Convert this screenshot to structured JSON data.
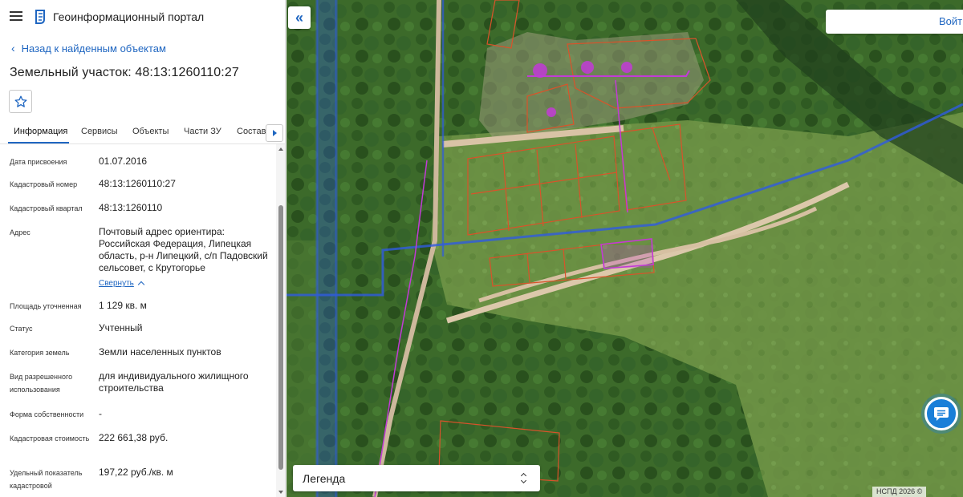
{
  "header": {
    "app_title": "Геоинформационный портал"
  },
  "nav": {
    "back_label": "Назад к найденным объектам"
  },
  "object": {
    "title": "Земельный участок: 48:13:1260110:27"
  },
  "tabs": [
    {
      "label": "Информация",
      "active": true
    },
    {
      "label": "Сервисы"
    },
    {
      "label": "Объекты"
    },
    {
      "label": "Части ЗУ"
    },
    {
      "label": "Состав"
    }
  ],
  "info": {
    "date_label": "Дата присвоения",
    "date_value": "01.07.2016",
    "cad_num_label": "Кадастровый номер",
    "cad_num_value": "48:13:1260110:27",
    "quarter_label": "Кадастровый квартал",
    "quarter_value": "48:13:1260110",
    "address_label": "Адрес",
    "address_value": "Почтовый адрес ориентира: Российская Федерация, Липецкая область, р-н Липецкий, с/п Падовский сельсовет, с Крутогорье",
    "collapse_label": "Свернуть",
    "area_label": "Площадь уточненная",
    "area_value": "1 129 кв. м",
    "status_label": "Статус",
    "status_value": "Учтенный",
    "category_label": "Категория земель",
    "category_value": "Земли населенных пунктов",
    "permitted_use_label": "Вид разрешенного использования",
    "permitted_use_value": "для индивидуального жилищного строительства",
    "ownership_label": "Форма собственности",
    "ownership_value": "-",
    "cad_value_label": "Кадастровая стоимость",
    "cad_value_value": "222 661,38 руб.",
    "specific_label": "Удельный показатель кадастровой",
    "specific_value": "197,22 руб./кв. м"
  },
  "map": {
    "search_label": "Войти",
    "legend_label": "Легенда",
    "attribution": "НСПД 2026 ©"
  },
  "icons": {
    "menu": "hamburger-icon",
    "logo": "logo-icon",
    "back": "chevron-left-icon",
    "favorite": "star-icon",
    "tabs_next": "chevron-right-icon",
    "collapse": "chevron-up-icon",
    "panel_toggle": "double-chevron-left-icon",
    "legend_toggle": "up-down-icon",
    "chat": "chat-icon"
  },
  "colors": {
    "accent": "#1f66c1",
    "chat": "#1a7fd8",
    "parcel_border": "#d9532a",
    "selected_parcel": "#c23bd6",
    "zone_line": "#2f5be0"
  }
}
